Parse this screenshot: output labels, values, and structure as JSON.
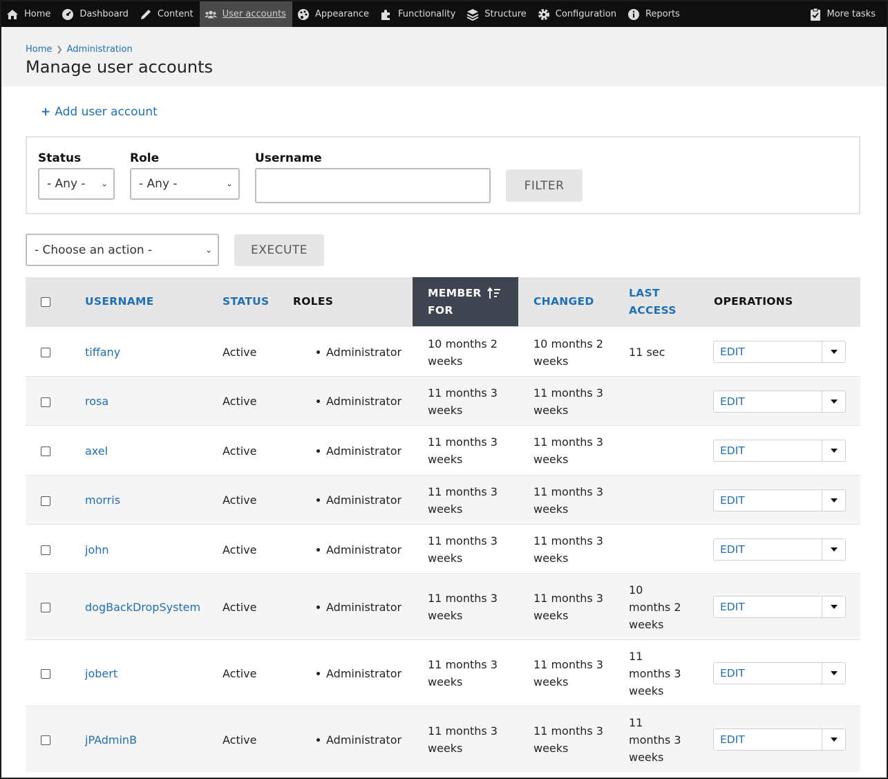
{
  "toolbar": {
    "items": [
      {
        "label": "Home",
        "icon": "home-icon"
      },
      {
        "label": "Dashboard",
        "icon": "dashboard-icon"
      },
      {
        "label": "Content",
        "icon": "pencil-icon"
      },
      {
        "label": "User accounts",
        "icon": "users-icon",
        "active": true
      },
      {
        "label": "Appearance",
        "icon": "palette-icon"
      },
      {
        "label": "Functionality",
        "icon": "puzzle-icon"
      },
      {
        "label": "Structure",
        "icon": "layers-icon"
      },
      {
        "label": "Configuration",
        "icon": "gear-icon"
      },
      {
        "label": "Reports",
        "icon": "info-icon"
      }
    ],
    "more_tasks": "More tasks"
  },
  "breadcrumb": [
    "Home",
    "Administration"
  ],
  "page_title": "Manage user accounts",
  "add_user_label": "Add user account",
  "filters": {
    "status_label": "Status",
    "status_value": "- Any -",
    "role_label": "Role",
    "role_value": "- Any -",
    "username_label": "Username",
    "username_value": "",
    "filter_button": "FILTER"
  },
  "bulk": {
    "action_value": "- Choose an action -",
    "execute_button": "EXECUTE"
  },
  "table": {
    "headers": {
      "username": "USERNAME",
      "status": "STATUS",
      "roles": "ROLES",
      "member_for_1": "MEMBER",
      "member_for_2": "FOR",
      "changed": "CHANGED",
      "last_access_1": "LAST",
      "last_access_2": "ACCESS",
      "operations": "OPERATIONS"
    },
    "rows": [
      {
        "username": "tiffany",
        "status": "Active",
        "role": "Administrator",
        "member_for": [
          "10 months 2",
          "weeks"
        ],
        "changed": [
          "10 months 2",
          "weeks"
        ],
        "last_access": [
          "11 sec"
        ],
        "edit": "EDIT"
      },
      {
        "username": "rosa",
        "status": "Active",
        "role": "Administrator",
        "member_for": [
          "11 months 3",
          "weeks"
        ],
        "changed": [
          "11 months 3",
          "weeks"
        ],
        "last_access": [],
        "edit": "EDIT"
      },
      {
        "username": "axel",
        "status": "Active",
        "role": "Administrator",
        "member_for": [
          "11 months 3",
          "weeks"
        ],
        "changed": [
          "11 months 3",
          "weeks"
        ],
        "last_access": [],
        "edit": "EDIT"
      },
      {
        "username": "morris",
        "status": "Active",
        "role": "Administrator",
        "member_for": [
          "11 months 3",
          "weeks"
        ],
        "changed": [
          "11 months 3",
          "weeks"
        ],
        "last_access": [],
        "edit": "EDIT"
      },
      {
        "username": "john",
        "status": "Active",
        "role": "Administrator",
        "member_for": [
          "11 months 3",
          "weeks"
        ],
        "changed": [
          "11 months 3",
          "weeks"
        ],
        "last_access": [],
        "edit": "EDIT"
      },
      {
        "username": "dogBackDropSystem",
        "status": "Active",
        "role": "Administrator",
        "member_for": [
          "11 months 3",
          "weeks"
        ],
        "changed": [
          "11 months 3",
          "weeks"
        ],
        "last_access": [
          "10",
          "months 2",
          "weeks"
        ],
        "edit": "EDIT"
      },
      {
        "username": "jobert",
        "status": "Active",
        "role": "Administrator",
        "member_for": [
          "11 months 3",
          "weeks"
        ],
        "changed": [
          "11 months 3",
          "weeks"
        ],
        "last_access": [
          "11",
          "months 3",
          "weeks"
        ],
        "edit": "EDIT"
      },
      {
        "username": "jPAdminB",
        "status": "Active",
        "role": "Administrator",
        "member_for": [
          "11 months 3",
          "weeks"
        ],
        "changed": [
          "11 months 3",
          "weeks"
        ],
        "last_access": [
          "11",
          "months 3",
          "weeks"
        ],
        "edit": "EDIT"
      }
    ]
  },
  "colors": {
    "link": "#1f6fb4",
    "toolbar_bg": "#0f0f0f",
    "sorted_header_bg": "#3f4550"
  }
}
